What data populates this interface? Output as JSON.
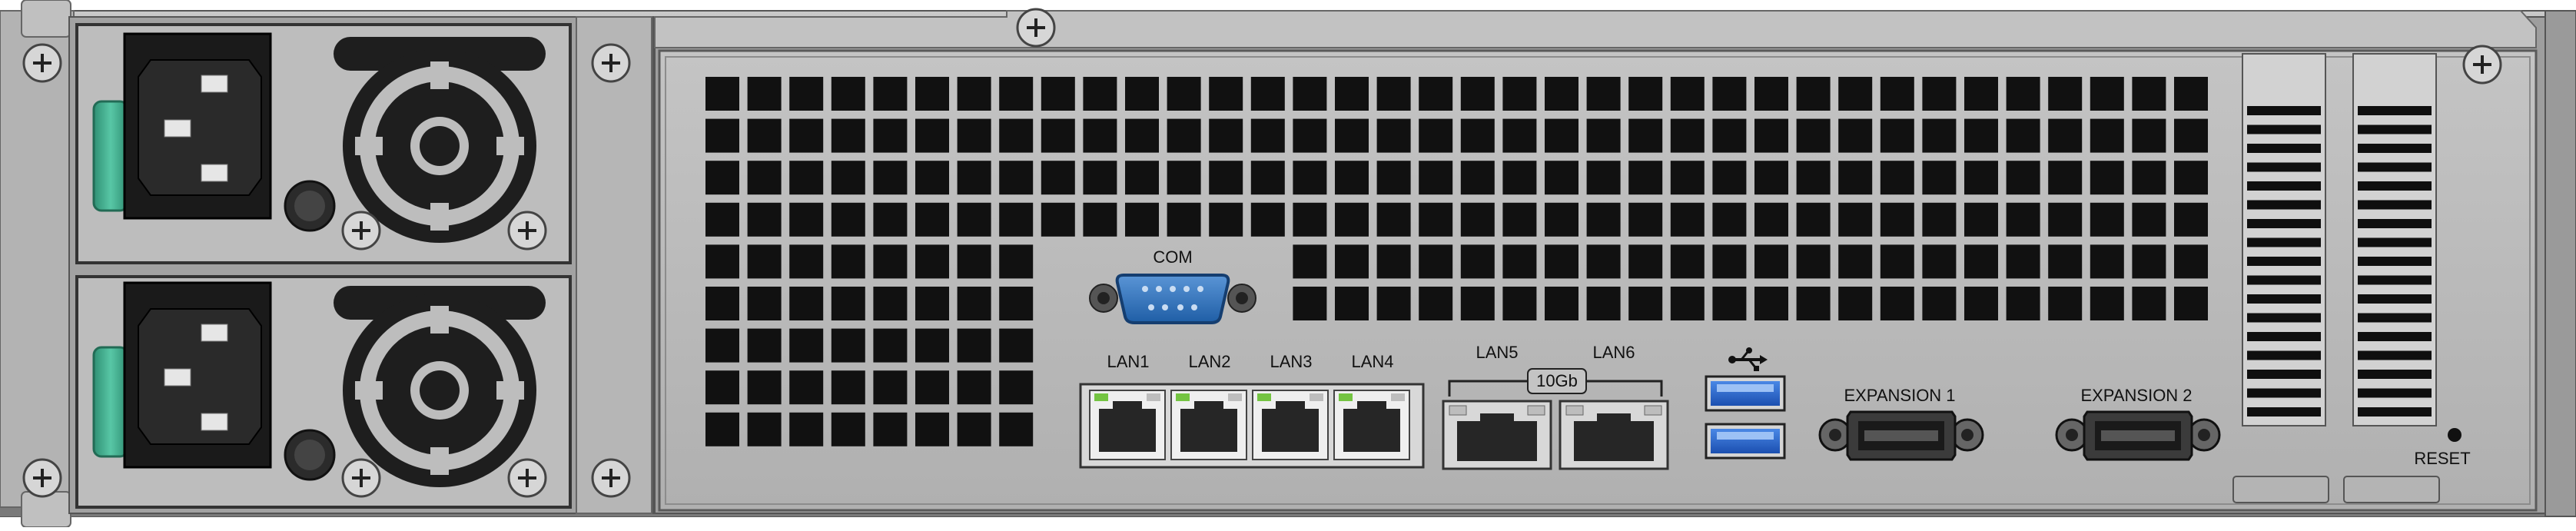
{
  "device": {
    "ports": {
      "com": "COM",
      "lan_1g": [
        "LAN1",
        "LAN2",
        "LAN3",
        "LAN4"
      ],
      "lan_10g": [
        "LAN5",
        "LAN6"
      ],
      "lan_10g_group": "10Gb",
      "expansion": [
        "EXPANSION 1",
        "EXPANSION 2"
      ],
      "reset": "RESET",
      "usb_icon": "usb-icon"
    },
    "colors": {
      "chassis": "#a3a3a3",
      "panel": "#b9b9b9",
      "vent": "#111111",
      "com_port": "#2f6fb5",
      "usb_port": "#2a64c4",
      "psu_handle": "#3daa8c",
      "lan_led": "#74c442"
    }
  }
}
